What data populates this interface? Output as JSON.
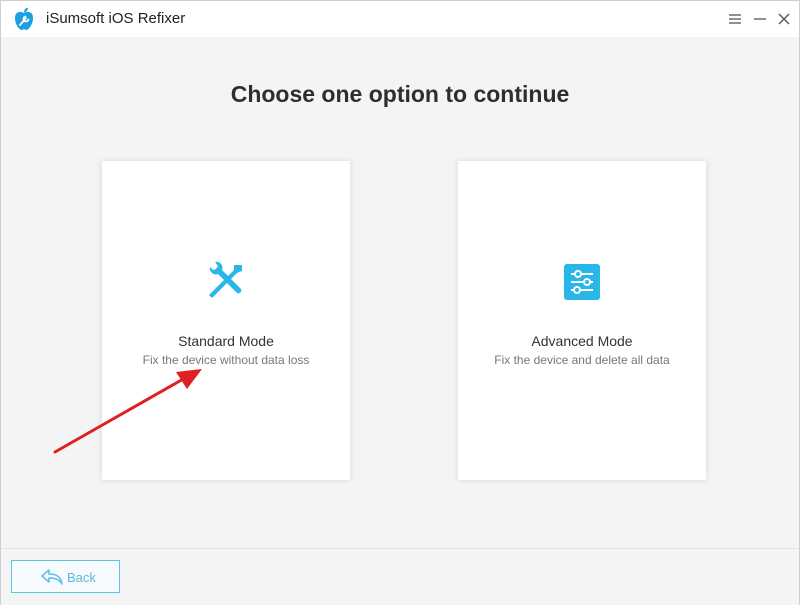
{
  "window": {
    "title": "iSumsoft iOS Refixer",
    "app_icon": "apple-wrench-icon",
    "controls": [
      "menu-icon",
      "minimize-icon",
      "close-icon"
    ]
  },
  "main": {
    "heading": "Choose one option to continue",
    "options": [
      {
        "title": "Standard Mode",
        "description": "Fix the device without data loss",
        "icon": "tools-icon"
      },
      {
        "title": "Advanced Mode",
        "description": "Fix the device and delete all data",
        "icon": "sliders-icon"
      }
    ]
  },
  "footer": {
    "back_label": "Back",
    "back_icon": "back-arrow-icon"
  },
  "colors": {
    "accent": "#29b6e8",
    "annotation_arrow": "#e02020"
  }
}
